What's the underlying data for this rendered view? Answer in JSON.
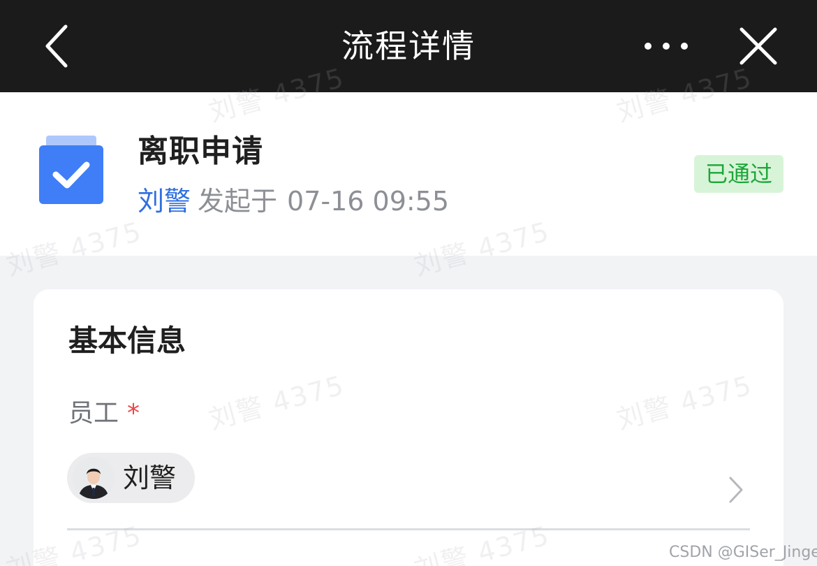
{
  "navbar": {
    "title": "流程详情"
  },
  "header": {
    "title": "离职申请",
    "initiator": "刘警",
    "initiated_label": "发起于",
    "initiated_time": "07-16 09:55",
    "status": "已通过",
    "status_color": "#1ea63a",
    "icon": "approval-check-icon",
    "icon_color": "#3f7ef6"
  },
  "basic_info": {
    "section_title": "基本信息",
    "employee_label": "员工",
    "required_mark": "*",
    "employee_name": "刘警"
  },
  "watermark": "刘警 4375",
  "credit": "CSDN @GISer_Jinger",
  "colors": {
    "accent": "#2f6fe0",
    "navbar_bg": "#1b1b1b",
    "page_bg": "#f2f3f5"
  }
}
